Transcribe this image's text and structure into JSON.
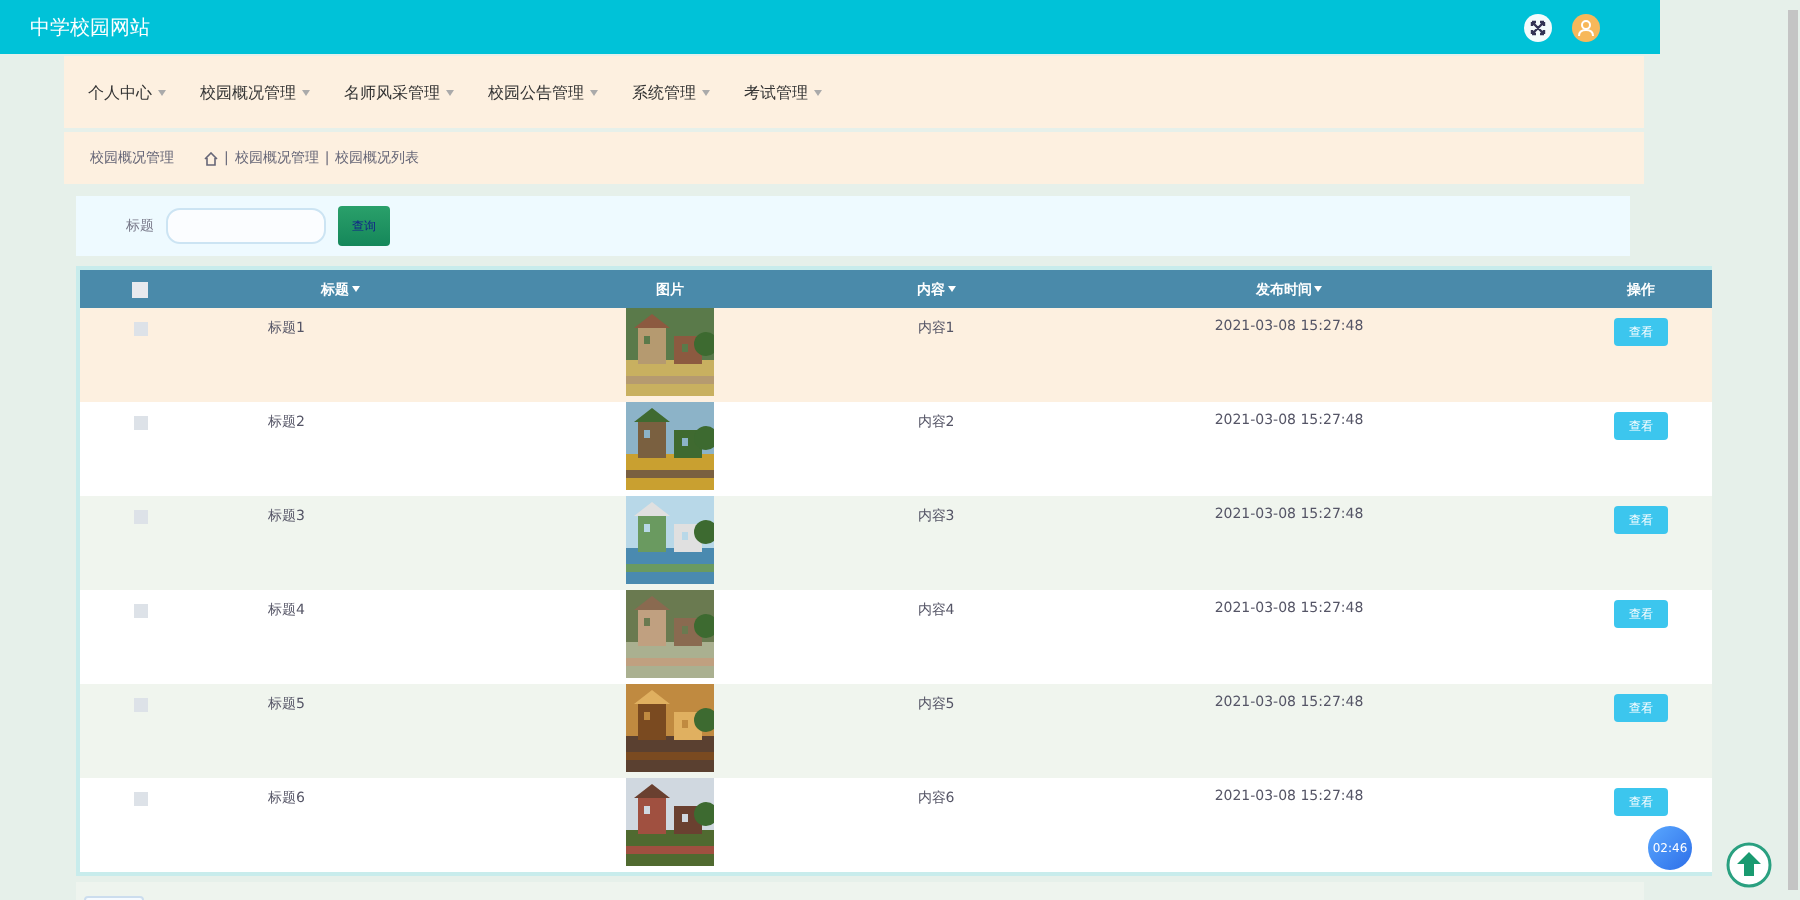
{
  "site_title": "中学校园网站",
  "nav": [
    {
      "label": "个人中心"
    },
    {
      "label": "校园概况管理"
    },
    {
      "label": "名师风采管理"
    },
    {
      "label": "校园公告管理"
    },
    {
      "label": "系统管理"
    },
    {
      "label": "考试管理"
    }
  ],
  "breadcrumb": {
    "title": "校园概况管理",
    "separator": "|",
    "path": [
      "校园概况管理",
      "校园概况列表"
    ]
  },
  "search": {
    "label": "标题",
    "button": "查询"
  },
  "table": {
    "all_checked": false,
    "columns": [
      {
        "label": "标题",
        "sortable": true
      },
      {
        "label": "图片",
        "sortable": false
      },
      {
        "label": "内容",
        "sortable": true
      },
      {
        "label": "发布时间",
        "sortable": true
      },
      {
        "label": "操作",
        "sortable": false
      }
    ],
    "rows": [
      {
        "checked": false,
        "highlighted": true,
        "title": "标题1",
        "content": "内容1",
        "time": "2021-03-08 15:27:48",
        "action": "查看"
      },
      {
        "checked": false,
        "highlighted": false,
        "title": "标题2",
        "content": "内容2",
        "time": "2021-03-08 15:27:48",
        "action": "查看"
      },
      {
        "checked": false,
        "highlighted": false,
        "title": "标题3",
        "content": "内容3",
        "time": "2021-03-08 15:27:48",
        "action": "查看"
      },
      {
        "checked": false,
        "highlighted": false,
        "title": "标题4",
        "content": "内容4",
        "time": "2021-03-08 15:27:48",
        "action": "查看"
      },
      {
        "checked": false,
        "highlighted": false,
        "title": "标题5",
        "content": "内容5",
        "time": "2021-03-08 15:27:48",
        "action": "查看"
      },
      {
        "checked": false,
        "highlighted": false,
        "title": "标题6",
        "content": "内容6",
        "time": "2021-03-08 15:27:48",
        "action": "查看"
      }
    ]
  },
  "timer": "02:46"
}
